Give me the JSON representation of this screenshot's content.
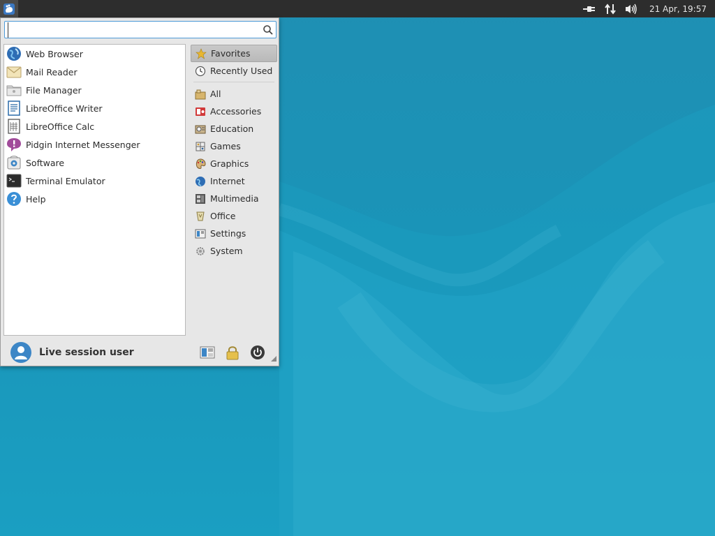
{
  "panel": {
    "clock": "21 Apr, 19:57"
  },
  "menu": {
    "search_placeholder": "",
    "favorites": [
      {
        "label": "Web Browser",
        "icon": "globe-icon"
      },
      {
        "label": "Mail Reader",
        "icon": "mail-icon"
      },
      {
        "label": "File Manager",
        "icon": "folder-icon"
      },
      {
        "label": "LibreOffice Writer",
        "icon": "writer-icon"
      },
      {
        "label": "LibreOffice Calc",
        "icon": "calc-icon"
      },
      {
        "label": "Pidgin Internet Messenger",
        "icon": "pidgin-icon"
      },
      {
        "label": "Software",
        "icon": "software-icon"
      },
      {
        "label": "Terminal Emulator",
        "icon": "terminal-icon"
      },
      {
        "label": "Help",
        "icon": "help-icon"
      }
    ],
    "categories_top": [
      {
        "label": "Favorites",
        "icon": "star-icon",
        "active": true
      },
      {
        "label": "Recently Used",
        "icon": "clock-icon",
        "active": false
      }
    ],
    "categories": [
      {
        "label": "All",
        "icon": "all-icon"
      },
      {
        "label": "Accessories",
        "icon": "accessories-icon"
      },
      {
        "label": "Education",
        "icon": "education-icon"
      },
      {
        "label": "Games",
        "icon": "games-icon"
      },
      {
        "label": "Graphics",
        "icon": "graphics-icon"
      },
      {
        "label": "Internet",
        "icon": "internet-icon"
      },
      {
        "label": "Multimedia",
        "icon": "multimedia-icon"
      },
      {
        "label": "Office",
        "icon": "office-icon"
      },
      {
        "label": "Settings",
        "icon": "settings-icon"
      },
      {
        "label": "System",
        "icon": "system-icon"
      }
    ],
    "username": "Live session user"
  },
  "colors": {
    "desktop": "#1a94b8",
    "panel": "#2d2d2d",
    "accent": "#4e9bd8"
  }
}
